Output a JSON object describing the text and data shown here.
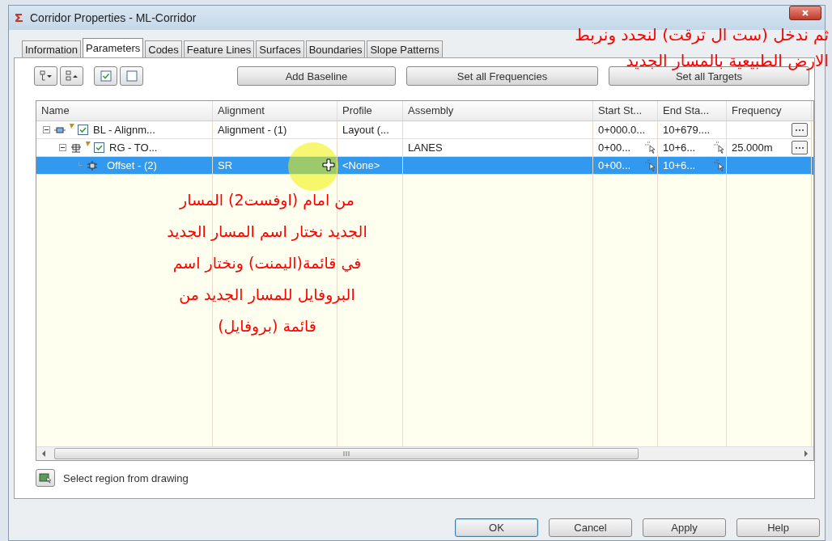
{
  "window": {
    "title": "Corridor Properties - ML-Corridor"
  },
  "tabs": [
    {
      "label": "Information",
      "selected": false
    },
    {
      "label": "Parameters",
      "selected": true
    },
    {
      "label": "Codes",
      "selected": false
    },
    {
      "label": "Feature Lines",
      "selected": false
    },
    {
      "label": "Surfaces",
      "selected": false
    },
    {
      "label": "Boundaries",
      "selected": false
    },
    {
      "label": "Slope Patterns",
      "selected": false
    }
  ],
  "toolbar": {
    "buttons": [
      "Add Baseline",
      "Set all Frequencies",
      "Set all Targets"
    ]
  },
  "table": {
    "columns": [
      "Name",
      "Alignment",
      "Profile",
      "Assembly",
      "Start St...",
      "End Sta...",
      "Frequency"
    ],
    "rows": [
      {
        "kind": "baseline",
        "name": "BL - Alignm...",
        "checked": true,
        "expanded": true,
        "selected": false,
        "alignment": "Alignment - (1)",
        "profile": "Layout (...",
        "start": "0+000.0...",
        "end": "10+679....",
        "children": [
          {
            "kind": "region",
            "name": "RG - TO...",
            "checked": true,
            "expanded": true,
            "selected": false,
            "assembly": "LANES",
            "start": "0+00...",
            "end": "10+6...",
            "frequency": "25.000m",
            "children": [
              {
                "kind": "offset",
                "name": "Offset - (2)",
                "selected": true,
                "alignment": "SR",
                "profile": "<None>",
                "start": "0+00...",
                "end": "10+6..."
              }
            ]
          }
        ]
      }
    ]
  },
  "select_region": {
    "label": "Select region from drawing"
  },
  "footer": {
    "buttons": [
      "OK",
      "Cancel",
      "Apply",
      "Help"
    ]
  },
  "annotations": [
    {
      "kind": "top-right",
      "text": "ثم ندخل (ست ال ترقت) لنحدد ونربط\nالارض الطبيعية بالمسار الجديد"
    },
    {
      "kind": "center",
      "text": "من امام (اوفست2) المسار\nالجديد  نختار اسم المسار الجديد\nفي قائمة(اليمنت) ونختار اسم\nالبروفايل للمسار الجديد من\nقائمة (بروفايل)"
    }
  ]
}
